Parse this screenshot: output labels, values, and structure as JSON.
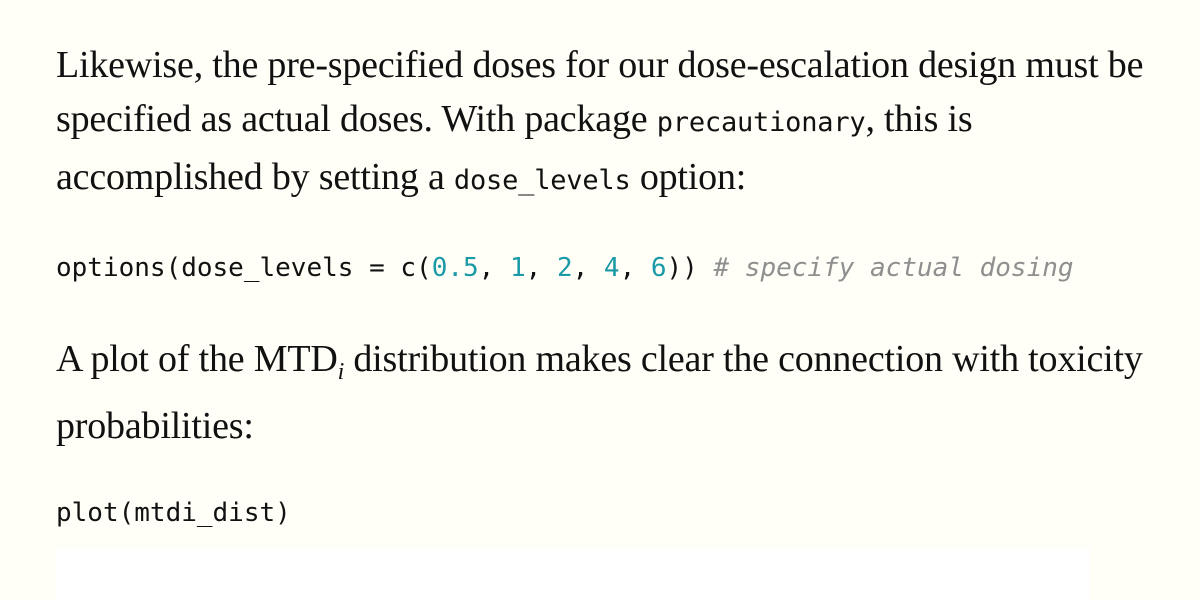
{
  "paragraph1": {
    "text_a": "Likewise, the pre-specified doses for our dose-escalation design must be specified as actual doses. With package ",
    "code_a": "precautionary",
    "text_b": ", this is accomplished by setting a ",
    "code_b": "dose_levels",
    "text_c": " option:"
  },
  "code_block1": {
    "prefix": "options(dose_levels = c(",
    "n1": "0.5",
    "sep1": ", ",
    "n2": "1",
    "sep2": ", ",
    "n3": "2",
    "sep3": ", ",
    "n4": "4",
    "sep4": ", ",
    "n5": "6",
    "suffix": ")) ",
    "comment": "# specify actual dosing"
  },
  "paragraph2": {
    "text_a": "A plot of the MTD",
    "subscript": "i",
    "text_b": " distribution makes clear the connection with toxicity probabilities:"
  },
  "code_block2": {
    "line": "plot(mtdi_dist)"
  },
  "colors": {
    "background": "#fffff8",
    "code_number": "#1a9aa6",
    "code_comment": "#8f8f8f",
    "plot_area": "#ffffff"
  }
}
